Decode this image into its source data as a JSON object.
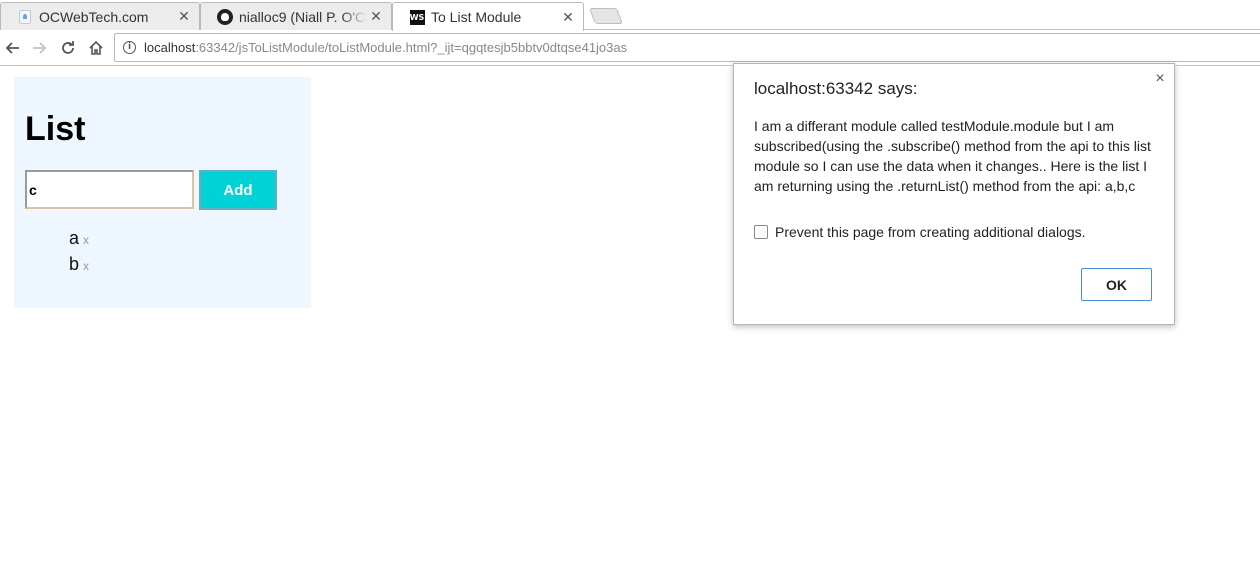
{
  "tabs": [
    {
      "title": "OCWebTech.com",
      "icon": "ocwebtech-favicon-icon"
    },
    {
      "title": "nialloc9 (Niall P. O'C",
      "icon": "github-icon"
    },
    {
      "title": "To List Module",
      "icon": "webstorm-icon",
      "active": true
    }
  ],
  "toolbar": {
    "url_host": "localhost",
    "url_rest": ":63342/jsToListModule/toListModule.html?_ijt=qgqtesjb5bbtv0dtqse41jo3as"
  },
  "module": {
    "heading": "List",
    "input_value": "c",
    "add_label": "Add",
    "items": [
      {
        "text": "a",
        "delete": "x"
      },
      {
        "text": "b",
        "delete": "x"
      }
    ]
  },
  "dialog": {
    "title": "localhost:63342 says:",
    "message": "I am a differant module called testModule.module but I am subscribed(using the .subscribe() method from the api to this list module so I can use the data when it changes.. Here is the list I am returning using the .returnList() method from the api: a,b,c",
    "checkbox_label": "Prevent this page from creating additional dialogs.",
    "ok_label": "OK",
    "close": "×"
  },
  "colors": {
    "module_bg": "#eef6ff",
    "add_button": "#00d3d8",
    "ok_border": "#4d8bd6"
  }
}
